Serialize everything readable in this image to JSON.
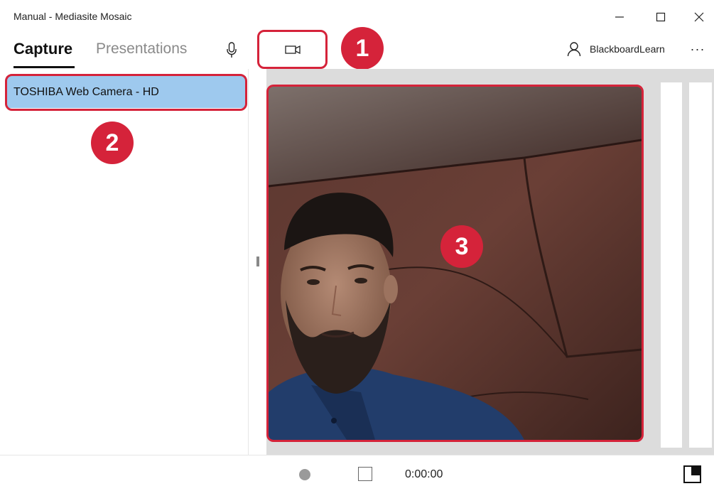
{
  "window": {
    "title": "Manual - Mediasite Mosaic",
    "controls": {
      "minimize": "—",
      "maximize": "☐",
      "close": "✕"
    }
  },
  "toolbar": {
    "tabs": [
      {
        "label": "Capture",
        "active": true
      },
      {
        "label": "Presentations",
        "active": false
      }
    ],
    "mic_icon": "microphone-icon",
    "camera_icon": "video-camera-icon",
    "user_name": "BlackboardLearn",
    "more_label": "···"
  },
  "sources": {
    "items": [
      {
        "label": "TOSHIBA Web Camera - HD",
        "selected": true
      }
    ]
  },
  "annotations": {
    "badge_1": "1",
    "badge_2": "2",
    "badge_3": "3",
    "color": "#d5233a"
  },
  "bottom": {
    "timer": "0:00:00"
  },
  "colors": {
    "selected_item": "#9ec9ee",
    "accent_red": "#d5233a",
    "preview_bg": "#dcdcdc"
  }
}
